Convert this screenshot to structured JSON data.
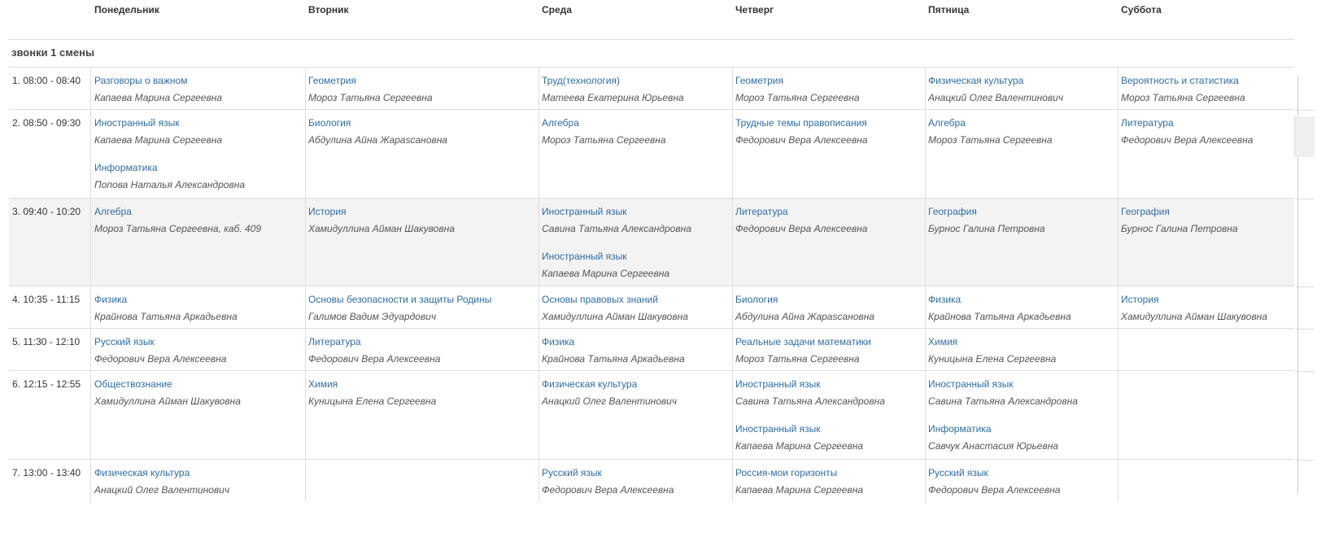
{
  "days": [
    "Понедельник",
    "Вторник",
    "Среда",
    "Четверг",
    "Пятница",
    "Суббота"
  ],
  "shift_title": "звонки 1 смены",
  "rows": [
    {
      "time": "1. 08:00 - 08:40",
      "cells": [
        [
          {
            "subject": "Разговоры о важном",
            "teacher": "Капаева Марина Сергеевна"
          }
        ],
        [
          {
            "subject": "Геометрия",
            "teacher": "Мороз Татьяна Сергеевна"
          }
        ],
        [
          {
            "subject": "Труд(технология)",
            "teacher": "Матеева Екатерина Юрьевна"
          }
        ],
        [
          {
            "subject": "Геометрия",
            "teacher": "Мороз Татьяна Сергеевна"
          }
        ],
        [
          {
            "subject": "Физическая культура",
            "teacher": "Анацкий Олег Валентинович"
          }
        ],
        [
          {
            "subject": "Вероятность и статистика",
            "teacher": "Мороз Татьяна Сергеевна"
          }
        ]
      ]
    },
    {
      "time": "2. 08:50 - 09:30",
      "cells": [
        [
          {
            "subject": "Иностранный язык",
            "teacher": "Капаева Марина Сергеевна"
          },
          {
            "subject": "Информатика",
            "teacher": "Попова Наталья Александровна"
          }
        ],
        [
          {
            "subject": "Биология",
            "teacher": "Абдулина Айна Жарascановна"
          }
        ],
        [
          {
            "subject": "Алгебра",
            "teacher": "Мороз Татьяна Сергеевна"
          }
        ],
        [
          {
            "subject": "Трудные темы правописания",
            "teacher": "Федорович Вера Алексеевна"
          }
        ],
        [
          {
            "subject": "Алгебра",
            "teacher": "Мороз Татьяна Сергеевна"
          }
        ],
        [
          {
            "subject": "Литература",
            "teacher": "Федорович Вера Алексеевна"
          }
        ]
      ]
    },
    {
      "time": "3. 09:40 - 10:20",
      "cells": [
        [
          {
            "subject": "Алгебра",
            "teacher": "Мороз Татьяна Сергеевна, каб. 409"
          }
        ],
        [
          {
            "subject": "История",
            "teacher": "Хамидуллина Айман Шакувовна"
          }
        ],
        [
          {
            "subject": "Иностранный язык",
            "teacher": "Савина Татьяна Александровна"
          },
          {
            "subject": "Иностранный язык",
            "teacher": "Капаева Марина Сергеевна"
          }
        ],
        [
          {
            "subject": "Литература",
            "teacher": "Федорович Вера Алексеевна"
          }
        ],
        [
          {
            "subject": "География",
            "teacher": "Бурнос Галина Петровна"
          }
        ],
        [
          {
            "subject": "География",
            "teacher": "Бурнос Галина Петровна"
          }
        ]
      ]
    },
    {
      "time": "4. 10:35 - 11:15",
      "cells": [
        [
          {
            "subject": "Физика",
            "teacher": "Крайнова Татьяна Аркадьевна"
          }
        ],
        [
          {
            "subject": "Основы безопасности и защиты Родины",
            "teacher": "Галимов Вадим Эдуардович"
          }
        ],
        [
          {
            "subject": "Основы правовых знаний",
            "teacher": "Хамидуллина Айман Шакувовна"
          }
        ],
        [
          {
            "subject": "Биология",
            "teacher": "Абдулина Айна Жарascановна"
          }
        ],
        [
          {
            "subject": "Физика",
            "teacher": "Крайнова Татьяна Аркадьевна"
          }
        ],
        [
          {
            "subject": "История",
            "teacher": "Хамидуллина Айман Шакувовна"
          }
        ]
      ]
    },
    {
      "time": "5. 11:30 - 12:10",
      "cells": [
        [
          {
            "subject": "Русский язык",
            "teacher": "Федорович Вера Алексеевна"
          }
        ],
        [
          {
            "subject": "Литература",
            "teacher": "Федорович Вера Алексеевна"
          }
        ],
        [
          {
            "subject": "Физика",
            "teacher": "Крайнова Татьяна Аркадьевна"
          }
        ],
        [
          {
            "subject": "Реальные задачи математики",
            "teacher": "Мороз Татьяна Сергеевна"
          }
        ],
        [
          {
            "subject": "Химия",
            "teacher": "Куницына Елена Сергеевна"
          }
        ],
        []
      ]
    },
    {
      "time": "6. 12:15 - 12:55",
      "cells": [
        [
          {
            "subject": "Обществознание",
            "teacher": "Хамидуллина Айман Шакувовна"
          }
        ],
        [
          {
            "subject": "Химия",
            "teacher": "Куницына Елена Сергеевна"
          }
        ],
        [
          {
            "subject": "Физическая культура",
            "teacher": "Анацкий Олег Валентинович"
          }
        ],
        [
          {
            "subject": "Иностранный язык",
            "teacher": "Савина Татьяна Александровна"
          },
          {
            "subject": "Иностранный язык",
            "teacher": "Капаева Марина Сергеевна"
          }
        ],
        [
          {
            "subject": "Иностранный язык",
            "teacher": "Савина Татьяна Александровна"
          },
          {
            "subject": "Информатика",
            "teacher": "Савчук Анастасия Юрьевна"
          }
        ],
        []
      ]
    },
    {
      "time": "7. 13:00 - 13:40",
      "cells": [
        [
          {
            "subject": "Физическая культура",
            "teacher": "Анацкий Олег Валентинович"
          }
        ],
        [],
        [
          {
            "subject": "Русский язык",
            "teacher": "Федорович Вера Алексеевна"
          }
        ],
        [
          {
            "subject": "Россия-мои горизонты",
            "teacher": "Капаева Марина Сергеевна"
          }
        ],
        [
          {
            "subject": "Русский язык",
            "teacher": "Федорович Вера Алексеевна"
          }
        ],
        []
      ]
    }
  ]
}
